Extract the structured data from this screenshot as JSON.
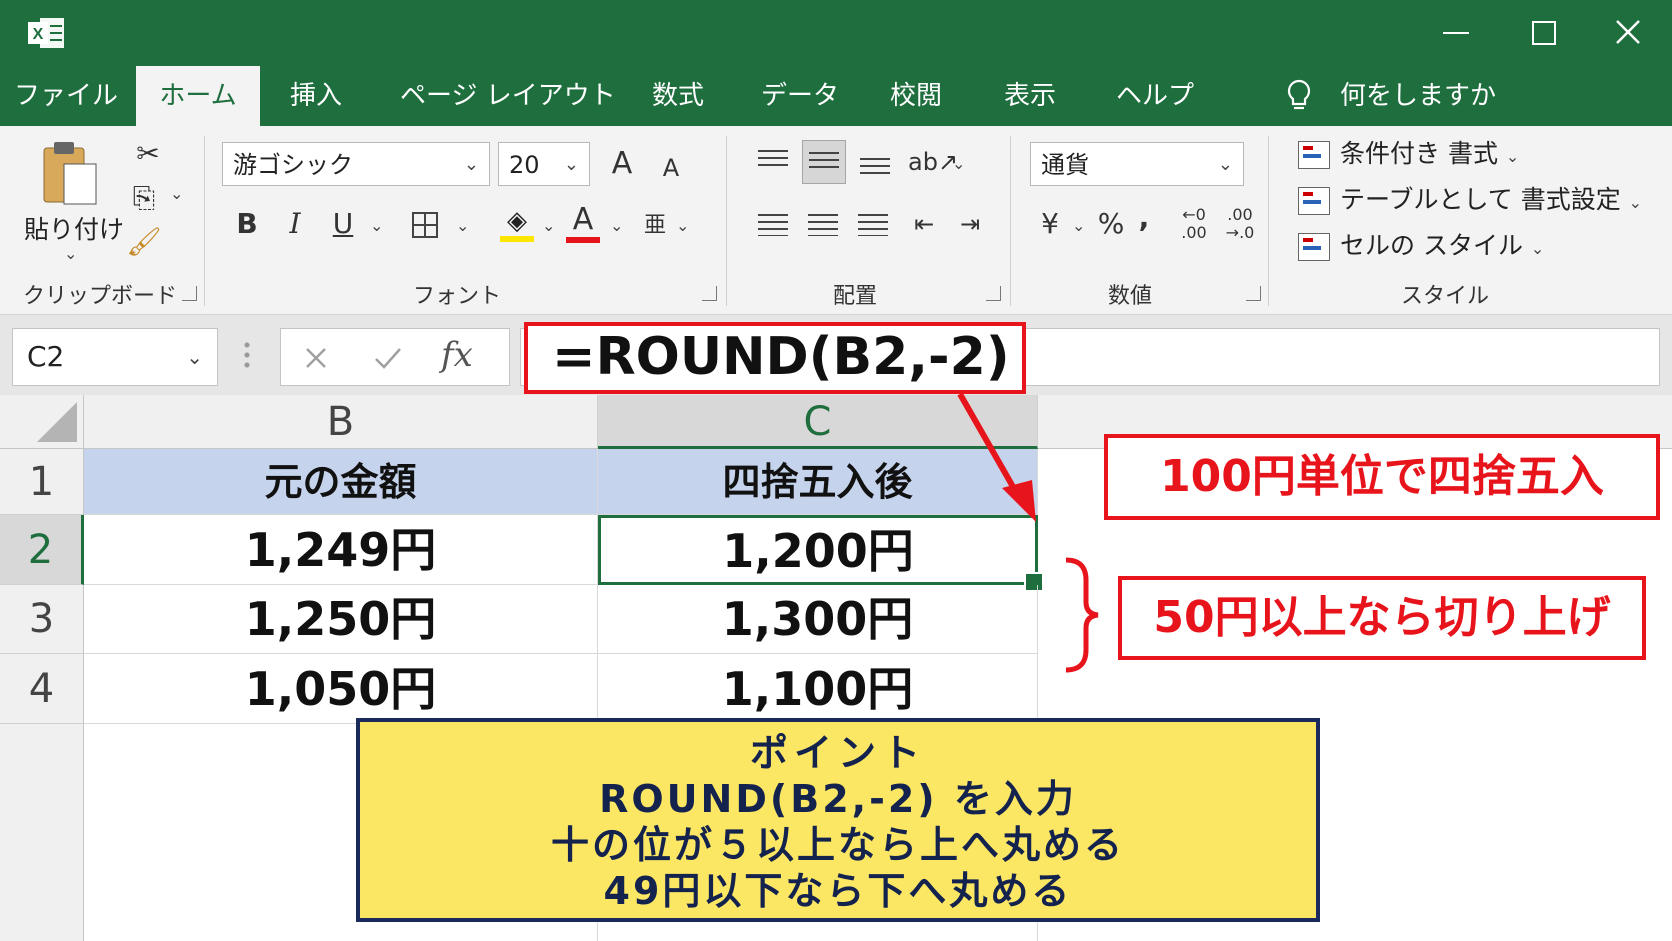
{
  "app": {
    "tabs": [
      "ファイル",
      "ホーム",
      "挿入",
      "ページ レイアウト",
      "数式",
      "データ",
      "校閲",
      "表示",
      "ヘルプ"
    ],
    "active_tab": "ホーム",
    "tell_me": "何をしますか"
  },
  "ribbon": {
    "clipboard": {
      "paste_label": "貼り付け",
      "group_label": "クリップボード"
    },
    "font": {
      "name": "游ゴシック",
      "size": "20",
      "bold": "B",
      "italic": "I",
      "underline": "U",
      "grow": "A",
      "shrink": "A",
      "font_color_glyph": "A",
      "group_label": "フォント"
    },
    "alignment": {
      "group_label": "配置"
    },
    "number": {
      "format": "通貨",
      "currency": "¥",
      "percent": "%",
      "comma": ",",
      "group_label": "数値"
    },
    "styles": {
      "items": [
        "条件付き 書式",
        "テーブルとして 書式設定",
        "セルの スタイル"
      ],
      "group_label": "スタイル"
    }
  },
  "formula_bar": {
    "name_box": "C2",
    "fx": "fx",
    "formula": "=ROUND(B2,-2)"
  },
  "sheet": {
    "columns": [
      "B",
      "C"
    ],
    "selected_column": "C",
    "rows": [
      {
        "num": "1",
        "b": "元の金額",
        "c": "四捨五入後"
      },
      {
        "num": "2",
        "b": "1,249円",
        "c": "1,200円"
      },
      {
        "num": "3",
        "b": "1,250円",
        "c": "1,300円"
      },
      {
        "num": "4",
        "b": "1,050円",
        "c": "1,100円"
      }
    ],
    "selected_row": "2"
  },
  "annotations": {
    "unit_note": "100円単位で四捨五入",
    "roundup_note": "50円以上なら切り上げ",
    "point": {
      "lines": [
        "ポイント",
        "ROUND(B2,-2) を入力",
        "十の位が５以上なら上へ丸める",
        "49円以下なら下へ丸める"
      ]
    }
  },
  "colors": {
    "excel_green": "#1e6e3e",
    "callout_red": "#e8141c",
    "point_yellow": "#fbe763",
    "header_blue": "#c5d4ec"
  }
}
